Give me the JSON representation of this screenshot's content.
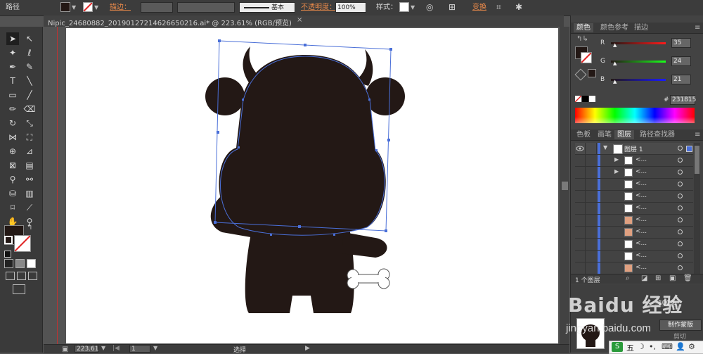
{
  "control_bar": {
    "object_type": "路径",
    "stroke_label": "描边：",
    "stroke_profile": "基本",
    "opacity_label": "不透明度：",
    "opacity_value": "100%",
    "style_label": "样式：",
    "transform_label": "变换"
  },
  "document_tab": {
    "title": "Nipic_24680882_20190127214626650216.ai* @ 223.61% (RGB/预览)",
    "close": "×"
  },
  "color_panel": {
    "tabs": [
      "颜色",
      "颜色参考",
      "描边"
    ],
    "r_label": "R",
    "g_label": "G",
    "b_label": "B",
    "r_value": "35",
    "g_value": "24",
    "b_value": "21",
    "hex_label": "#",
    "hex_value": "231815",
    "fill_color": "#231815"
  },
  "layers_panel": {
    "tabs": [
      "色板",
      "画笔",
      "图层",
      "路径查找器"
    ],
    "top_layer_name": "图层 1",
    "sublayer_name": "<...",
    "footer_count": "1 个图层"
  },
  "status_bar": {
    "zoom": "223.61",
    "page": "1",
    "tool_name": "选择"
  },
  "watermark": {
    "brand": "Baidu 经验",
    "url": "jingyan.baidu.com",
    "overlay_label": "制作蒙版",
    "overlay_label2": "剪切",
    "opacity_hint": "100%",
    "ime_text": "五"
  }
}
